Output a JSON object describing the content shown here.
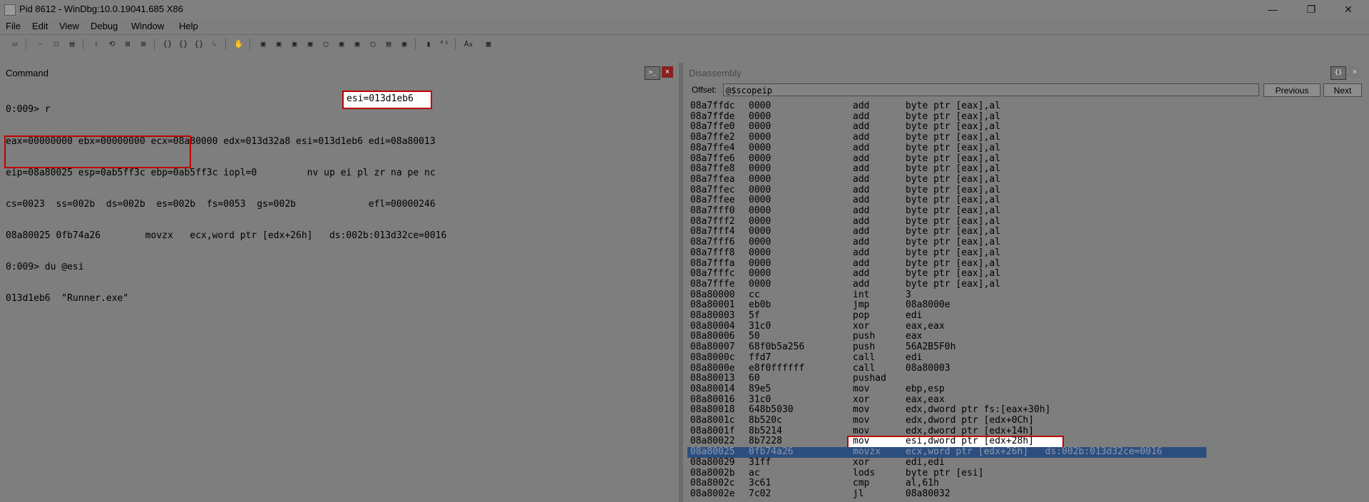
{
  "window": {
    "title": "Pid 8612 - WinDbg:10.0.19041.685 X86",
    "controls": {
      "minimize": "—",
      "maximize": "❐",
      "close": "✕"
    }
  },
  "menu": [
    "File",
    "Edit",
    "View",
    "Debug",
    "Window",
    "Help"
  ],
  "command_panel": {
    "title": "Command",
    "lines": [
      "0:009> r",
      "eax=00000000 ebx=00000000 ecx=08a80000 edx=013d32a8 esi=013d1eb6 edi=08a80013",
      "eip=08a80025 esp=0ab5ff3c ebp=0ab5ff3c iopl=0         nv up ei pl zr na pe nc",
      "cs=0023  ss=002b  ds=002b  es=002b  fs=0053  gs=002b             efl=00000246",
      "08a80025 0fb74a26        movzx   ecx,word ptr [edx+26h]   ds:002b:013d32ce=0016",
      "0:009> du @esi",
      "013d1eb6  \"Runner.exe\""
    ],
    "highlight_esi": "esi=013d1eb6"
  },
  "disassembly_panel": {
    "title": "Disassembly",
    "offset_label": "Offset:",
    "offset_value": "@$scopeip",
    "previous_label": "Previous",
    "next_label": "Next",
    "rows": [
      {
        "addr": "08a7ffdc",
        "hex": "0000",
        "mn": "add",
        "op": "byte ptr [eax],al"
      },
      {
        "addr": "08a7ffde",
        "hex": "0000",
        "mn": "add",
        "op": "byte ptr [eax],al"
      },
      {
        "addr": "08a7ffe0",
        "hex": "0000",
        "mn": "add",
        "op": "byte ptr [eax],al"
      },
      {
        "addr": "08a7ffe2",
        "hex": "0000",
        "mn": "add",
        "op": "byte ptr [eax],al"
      },
      {
        "addr": "08a7ffe4",
        "hex": "0000",
        "mn": "add",
        "op": "byte ptr [eax],al"
      },
      {
        "addr": "08a7ffe6",
        "hex": "0000",
        "mn": "add",
        "op": "byte ptr [eax],al"
      },
      {
        "addr": "08a7ffe8",
        "hex": "0000",
        "mn": "add",
        "op": "byte ptr [eax],al"
      },
      {
        "addr": "08a7ffea",
        "hex": "0000",
        "mn": "add",
        "op": "byte ptr [eax],al"
      },
      {
        "addr": "08a7ffec",
        "hex": "0000",
        "mn": "add",
        "op": "byte ptr [eax],al"
      },
      {
        "addr": "08a7ffee",
        "hex": "0000",
        "mn": "add",
        "op": "byte ptr [eax],al"
      },
      {
        "addr": "08a7fff0",
        "hex": "0000",
        "mn": "add",
        "op": "byte ptr [eax],al"
      },
      {
        "addr": "08a7fff2",
        "hex": "0000",
        "mn": "add",
        "op": "byte ptr [eax],al"
      },
      {
        "addr": "08a7fff4",
        "hex": "0000",
        "mn": "add",
        "op": "byte ptr [eax],al"
      },
      {
        "addr": "08a7fff6",
        "hex": "0000",
        "mn": "add",
        "op": "byte ptr [eax],al"
      },
      {
        "addr": "08a7fff8",
        "hex": "0000",
        "mn": "add",
        "op": "byte ptr [eax],al"
      },
      {
        "addr": "08a7fffa",
        "hex": "0000",
        "mn": "add",
        "op": "byte ptr [eax],al"
      },
      {
        "addr": "08a7fffc",
        "hex": "0000",
        "mn": "add",
        "op": "byte ptr [eax],al"
      },
      {
        "addr": "08a7fffe",
        "hex": "0000",
        "mn": "add",
        "op": "byte ptr [eax],al"
      },
      {
        "addr": "08a80000",
        "hex": "cc",
        "mn": "int",
        "op": "3"
      },
      {
        "addr": "08a80001",
        "hex": "eb0b",
        "mn": "jmp",
        "op": "08a8000e"
      },
      {
        "addr": "08a80003",
        "hex": "5f",
        "mn": "pop",
        "op": "edi"
      },
      {
        "addr": "08a80004",
        "hex": "31c0",
        "mn": "xor",
        "op": "eax,eax"
      },
      {
        "addr": "08a80006",
        "hex": "50",
        "mn": "push",
        "op": "eax"
      },
      {
        "addr": "08a80007",
        "hex": "68f0b5a256",
        "mn": "push",
        "op": "56A2B5F0h"
      },
      {
        "addr": "08a8000c",
        "hex": "ffd7",
        "mn": "call",
        "op": "edi"
      },
      {
        "addr": "08a8000e",
        "hex": "e8f0ffffff",
        "mn": "call",
        "op": "08a80003"
      },
      {
        "addr": "08a80013",
        "hex": "60",
        "mn": "pushad",
        "op": ""
      },
      {
        "addr": "08a80014",
        "hex": "89e5",
        "mn": "mov",
        "op": "ebp,esp"
      },
      {
        "addr": "08a80016",
        "hex": "31c0",
        "mn": "xor",
        "op": "eax,eax"
      },
      {
        "addr": "08a80018",
        "hex": "648b5030",
        "mn": "mov",
        "op": "edx,dword ptr fs:[eax+30h]"
      },
      {
        "addr": "08a8001c",
        "hex": "8b520c",
        "mn": "mov",
        "op": "edx,dword ptr [edx+0Ch]"
      },
      {
        "addr": "08a8001f",
        "hex": "8b5214",
        "mn": "mov",
        "op": "edx,dword ptr [edx+14h]"
      },
      {
        "addr": "08a80022",
        "hex": "8b7228",
        "mn": "mov",
        "op": "esi,dword ptr [edx+28h]"
      },
      {
        "addr": "08a80025",
        "hex": "0fb74a26",
        "mn": "movzx",
        "op": "ecx,word ptr [edx+26h]   ds:002b:013d32ce=0016"
      },
      {
        "addr": "08a80029",
        "hex": "31ff",
        "mn": "xor",
        "op": "edi,edi"
      },
      {
        "addr": "08a8002b",
        "hex": "ac",
        "mn": "lods",
        "op": "byte ptr [esi]"
      },
      {
        "addr": "08a8002c",
        "hex": "3c61",
        "mn": "cmp",
        "op": "al,61h"
      },
      {
        "addr": "08a8002e",
        "hex": "7c02",
        "mn": "jl",
        "op": "08a80032"
      }
    ],
    "current_row_addr": "08a80025",
    "marked_row_addr": "08a80022"
  },
  "icons": {
    "open": "folder-open-icon",
    "cut": "cut-icon",
    "copy": "copy-icon",
    "paste": "paste-icon",
    "font": "font-icon",
    "options": "options-icon"
  },
  "colors": {
    "background": "#7e7e7e",
    "highlight_border": "#c00000",
    "current_line": "#2c4e7f"
  }
}
